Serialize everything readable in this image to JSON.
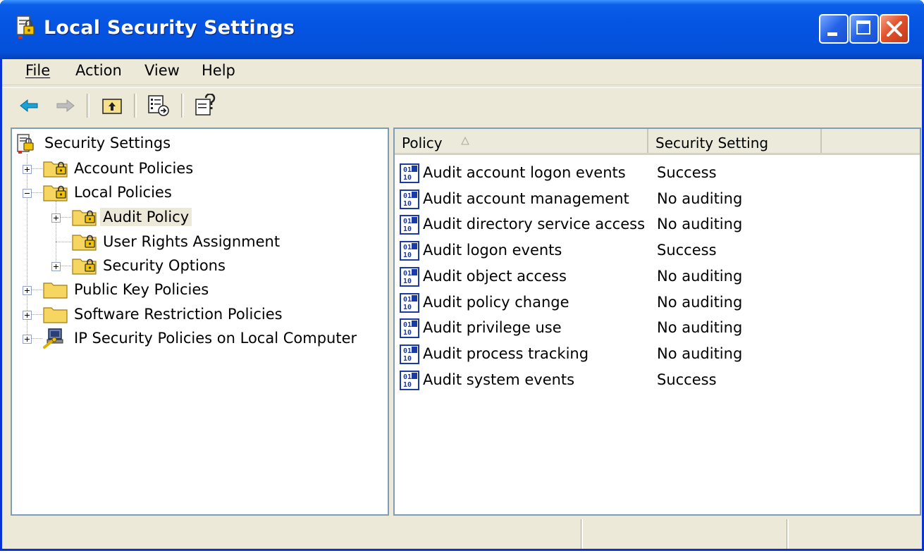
{
  "window": {
    "title": "Local Security Settings"
  },
  "menu": {
    "file": "File",
    "action": "Action",
    "view": "View",
    "help": "Help"
  },
  "toolbar": {
    "icons": [
      "back-arrow-icon",
      "forward-arrow-icon",
      "up-folder-icon",
      "export-list-icon",
      "help-icon"
    ]
  },
  "tree": {
    "root": "Security Settings",
    "account_policies": "Account Policies",
    "local_policies": "Local Policies",
    "audit_policy": "Audit Policy",
    "user_rights": "User Rights Assignment",
    "security_options": "Security Options",
    "public_key": "Public Key Policies",
    "software_restriction": "Software Restriction Policies",
    "ip_security": "IP Security Policies on Local Computer"
  },
  "list": {
    "columns": {
      "policy": "Policy",
      "setting": "Security Setting"
    },
    "rows": [
      {
        "policy": "Audit account logon events",
        "setting": "Success"
      },
      {
        "policy": "Audit account management",
        "setting": "No auditing"
      },
      {
        "policy": "Audit directory service access",
        "setting": "No auditing"
      },
      {
        "policy": "Audit logon events",
        "setting": "Success"
      },
      {
        "policy": "Audit object access",
        "setting": "No auditing"
      },
      {
        "policy": "Audit policy change",
        "setting": "No auditing"
      },
      {
        "policy": "Audit privilege use",
        "setting": "No auditing"
      },
      {
        "policy": "Audit process tracking",
        "setting": "No auditing"
      },
      {
        "policy": "Audit system events",
        "setting": "Success"
      }
    ]
  },
  "colors": {
    "titlebar": "#0554e3",
    "accent_border": "#0831d9",
    "chrome": "#ece9d8",
    "close_button": "#e1522c"
  }
}
